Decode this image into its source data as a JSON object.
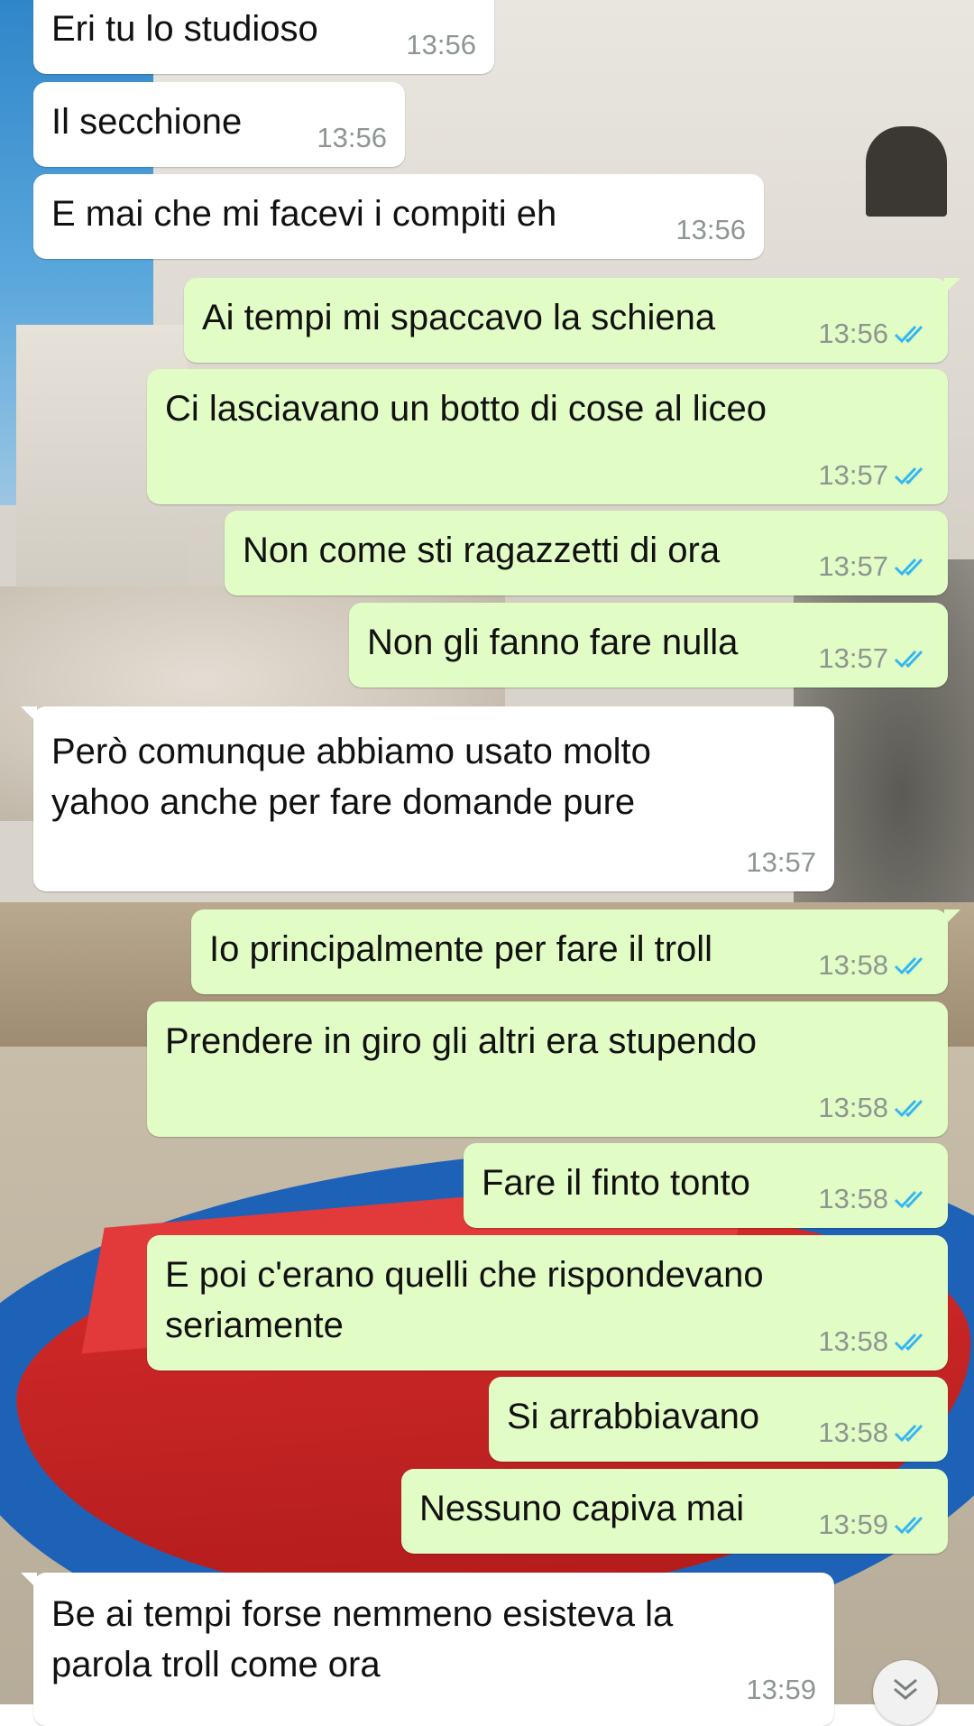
{
  "conversation": {
    "messages": [
      {
        "dir": "in",
        "text": "Eri tu lo studioso",
        "time": "13:56"
      },
      {
        "dir": "in",
        "text": "Il secchione",
        "time": "13:56"
      },
      {
        "dir": "in",
        "text": "E mai che mi facevi i compiti eh",
        "time": "13:56"
      },
      {
        "dir": "out",
        "text": "Ai tempi mi spaccavo la schiena",
        "time": "13:56",
        "status": "read"
      },
      {
        "dir": "out",
        "text": "Ci lasciavano un botto di cose al liceo",
        "time": "13:57",
        "status": "read"
      },
      {
        "dir": "out",
        "text": "Non come sti ragazzetti di ora",
        "time": "13:57",
        "status": "read"
      },
      {
        "dir": "out",
        "text": "Non gli fanno fare nulla",
        "time": "13:57",
        "status": "read"
      },
      {
        "dir": "in",
        "text": "Però comunque abbiamo usato molto\nyahoo anche per fare domande pure",
        "time": "13:57"
      },
      {
        "dir": "out",
        "text": "Io principalmente per fare il troll",
        "time": "13:58",
        "status": "read"
      },
      {
        "dir": "out",
        "text": "Prendere in giro gli altri era stupendo",
        "time": "13:58",
        "status": "read"
      },
      {
        "dir": "out",
        "text": "Fare il finto tonto",
        "time": "13:58",
        "status": "read"
      },
      {
        "dir": "out",
        "text": "E poi c'erano quelli che rispondevano\nseriamente",
        "time": "13:58",
        "status": "read"
      },
      {
        "dir": "out",
        "text": "Si arrabbiavano",
        "time": "13:58",
        "status": "read"
      },
      {
        "dir": "out",
        "text": "Nessuno capiva mai",
        "time": "13:59",
        "status": "read"
      },
      {
        "dir": "in",
        "text": "Be ai tempi forse nemmeno esisteva la\nparola troll come ora",
        "time": "13:59"
      }
    ]
  },
  "colors": {
    "incoming_bubble": "#ffffff",
    "outgoing_bubble": "#e2fcc6",
    "timestamp": "#8d9691",
    "read_tick": "#34b7f1"
  },
  "icons": {
    "read_receipt": "double-check-icon",
    "scroll_down": "chevron-double-down-icon"
  }
}
